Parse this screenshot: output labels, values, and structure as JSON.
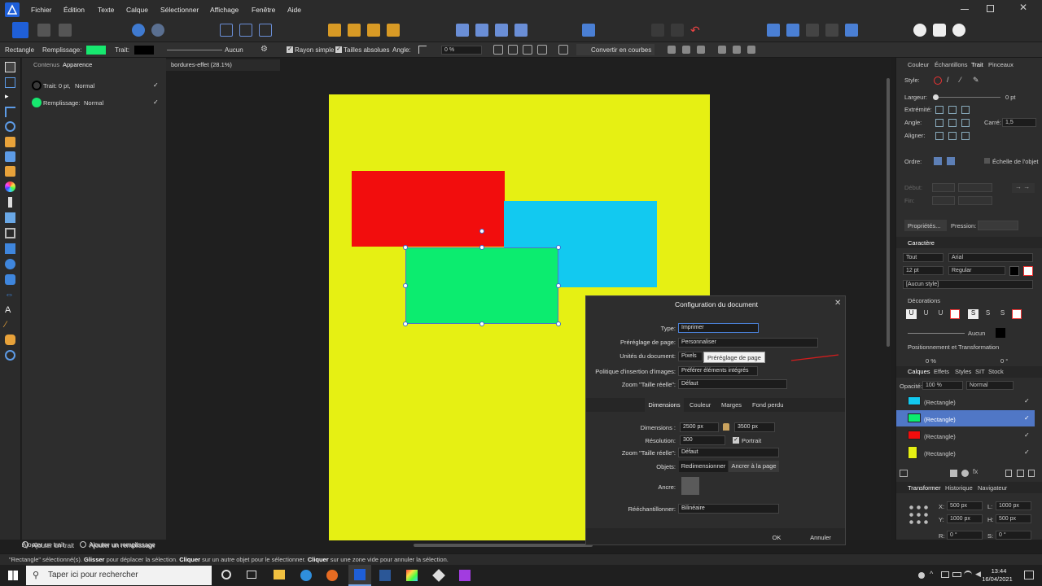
{
  "menu": [
    "Fichier",
    "Édition",
    "Texte",
    "Calque",
    "Sélectionner",
    "Affichage",
    "Fenêtre",
    "Aide"
  ],
  "context": {
    "tool_name": "Rectangle",
    "fill_label": "Remplissage:",
    "fill_color": "#17e86f",
    "stroke_label": "Trait:",
    "stroke_color": "#000000",
    "stroke_none": "Aucun",
    "rayon_simple": "Rayon simple",
    "tailles_absolues": "Tailles absolues",
    "angle_label": "Angle:",
    "angle_value": "0 %",
    "convert": "Convertir en courbes"
  },
  "left_panel": {
    "tabs": [
      "Contenus",
      "Apparence"
    ],
    "stroke_row": {
      "label": "Trait: 0 pt,",
      "mode": "Normal"
    },
    "fill_row": {
      "label": "Remplissage:",
      "mode": "Normal",
      "color": "#17e86f"
    },
    "add_stroke": "Ajouter un trait",
    "add_fill": "Ajouter un remplissage"
  },
  "doc_tab": "bordures-effet (28.1%)",
  "canvas": {
    "page_color": "#e6f013",
    "rects": [
      {
        "name": "red-rectangle",
        "color": "#f20d0d"
      },
      {
        "name": "cyan-rectangle",
        "color": "#12c9f0"
      },
      {
        "name": "green-rectangle",
        "color": "#0cec6f"
      }
    ]
  },
  "right_panel": {
    "tabs": [
      "Couleur",
      "Échantillons",
      "Trait",
      "Pinceaux"
    ],
    "style_label": "Style:",
    "largeur_label": "Largeur:",
    "largeur_value": "0 pt",
    "extremite_label": "Extrémité:",
    "angle_label": "Angle:",
    "carre_label": "Carré:",
    "carre_value": "1,5",
    "aligner_label": "Aligner:",
    "ordre_label": "Ordre:",
    "echelle_label": "Échelle de l'objet",
    "debut_label": "Début:",
    "fin_label": "Fin:",
    "proprietes": "Propriétés...",
    "pression_label": "Pression:",
    "caractere_tab": "Caractère",
    "tout": "Tout",
    "font": "Arial",
    "size": "12 pt",
    "weight": "Regular",
    "style_none": "[Aucun style]",
    "decorations": "Décorations",
    "deco_none": "Aucun",
    "positioning": "Positionnement et Transformation",
    "pt_field1": "0 %",
    "pt_field2": "0 °",
    "layer_tabs": [
      "Calques",
      "Effets",
      "Styles",
      "SIT",
      "Stock"
    ],
    "opacity_label": "Opacité:",
    "opacity_value": "100 %",
    "blend": "Normal",
    "layers": [
      {
        "label": "(Rectangle)",
        "color": "#12c9f0",
        "selected": false
      },
      {
        "label": "(Rectangle)",
        "color": "#0cec6f",
        "selected": true
      },
      {
        "label": "(Rectangle)",
        "color": "#f20d0d",
        "selected": false
      },
      {
        "label": "(Rectangle)",
        "color": "#e6f013",
        "selected": false
      }
    ],
    "transform_tabs": [
      "Transformer",
      "Historique",
      "Navigateur"
    ],
    "x_label": "X:",
    "x_value": "500 px",
    "y_label": "Y:",
    "y_value": "1000 px",
    "w_label": "L:",
    "w_value": "1000 px",
    "h_label": "H:",
    "h_value": "500 px",
    "r_label": "R:",
    "r_value": "0 °",
    "s_label": "S:",
    "s_value": "0 °"
  },
  "dialog": {
    "title": "Configuration du document",
    "type_label": "Type:",
    "type_value": "Imprimer",
    "preset_label": "Préréglage de page:",
    "preset_value": "Personnaliser",
    "units_label": "Unités du document:",
    "units_value": "Pixels",
    "tooltip": "Préréglage de page",
    "policy_label": "Politique d'insertion d'images:",
    "policy_value": "Préférer éléments intégrés",
    "zoom_label": "Zoom \"Taille réelle\":",
    "zoom_value": "Défaut",
    "tabs": [
      "Dimensions",
      "Couleur",
      "Marges",
      "Fond perdu"
    ],
    "dim_label": "Dimensions :",
    "dim_w": "2500 px",
    "dim_h": "3500 px",
    "res_label": "Résolution:",
    "res_value": "300",
    "portrait": "Portrait",
    "zoom2_label": "Zoom \"Taille réelle\":",
    "zoom2_value": "Défaut",
    "objets_label": "Objets:",
    "resize_btn": "Redimensionner",
    "anchor_btn": "Ancrer à la page",
    "ancre_label": "Ancre:",
    "resample_label": "Rééchantillonner:",
    "resample_value": "Bilinéaire",
    "ok": "OK",
    "cancel": "Annuler"
  },
  "status": {
    "quoted": "\"Rectangle\" sélectionné(s).",
    "b1": "Glisser",
    "t1": " pour déplacer la sélection. ",
    "b2": "Cliquer",
    "t2": " sur un autre objet pour le sélectionner. ",
    "b3": "Cliquer",
    "t3": " sur une zone vide pour annuler la sélection."
  },
  "taskbar": {
    "search_placeholder": "Taper ici pour rechercher",
    "time": "13:44",
    "date": "16/04/2021"
  },
  "colors": {
    "accent": "#4a7fd4",
    "selection": "#4f74c4"
  }
}
